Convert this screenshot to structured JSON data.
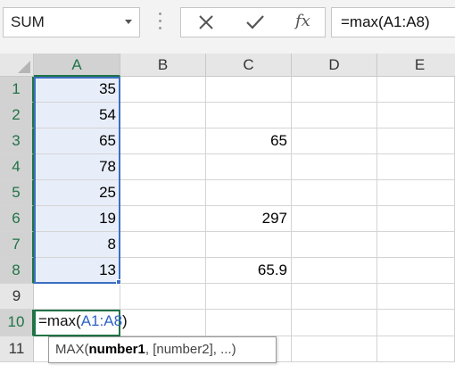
{
  "name_box": {
    "value": "SUM"
  },
  "formula_bar": {
    "fx_label": "fx",
    "formula": "=max(A1:A8)"
  },
  "columns": [
    "A",
    "B",
    "C",
    "D",
    "E"
  ],
  "rows": [
    "1",
    "2",
    "3",
    "4",
    "5",
    "6",
    "7",
    "8",
    "9",
    "10",
    "11"
  ],
  "cells": {
    "A1": "35",
    "A2": "54",
    "A3": "65",
    "A4": "78",
    "A5": "25",
    "A6": "19",
    "A7": "8",
    "A8": "13",
    "C3": "65",
    "C6": "297",
    "C8": "65.9"
  },
  "edit_cell": {
    "prefix": "=max(",
    "ref_start": "A1",
    "sep": ":",
    "ref_end": "A8",
    "suffix": ")"
  },
  "tooltip": {
    "func": "MAX(",
    "arg1": "number1",
    "rest": ", [number2], ...)"
  },
  "colors": {
    "accent": "#217346",
    "range": "#3c6fc4",
    "range_fill": "#e8eef9"
  },
  "icons": [
    "cancel-icon",
    "enter-icon",
    "insert-function-icon",
    "dropdown-arrow-icon"
  ]
}
